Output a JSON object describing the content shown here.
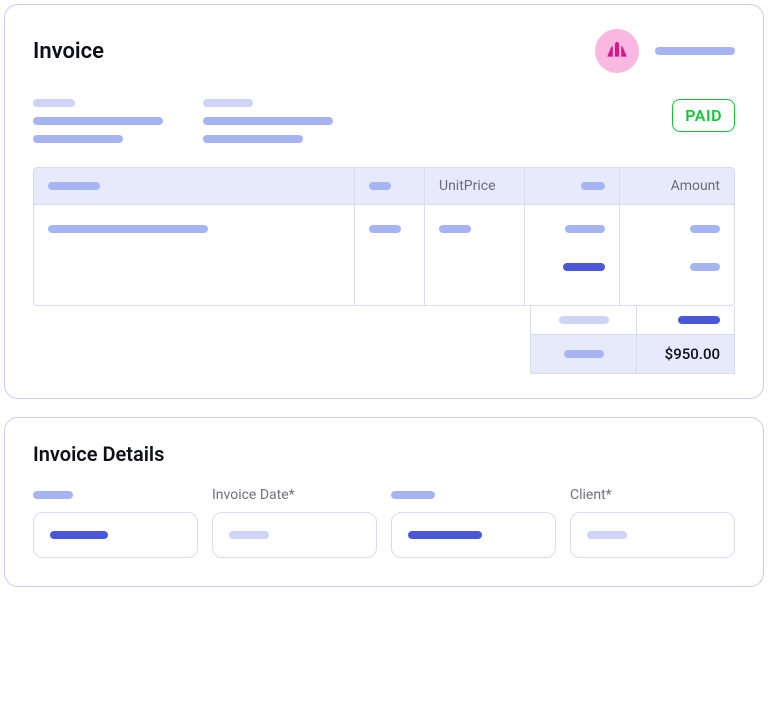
{
  "invoice": {
    "title": "Invoice",
    "status_badge": "PAID",
    "table": {
      "headers": {
        "unit_price": "UnitPrice",
        "amount": "Amount"
      },
      "total_value": "$950.00"
    }
  },
  "details": {
    "title": "Invoice Details",
    "fields": [
      {
        "label": ""
      },
      {
        "label": "Invoice Date*"
      },
      {
        "label": ""
      },
      {
        "label": "Client*"
      }
    ]
  }
}
